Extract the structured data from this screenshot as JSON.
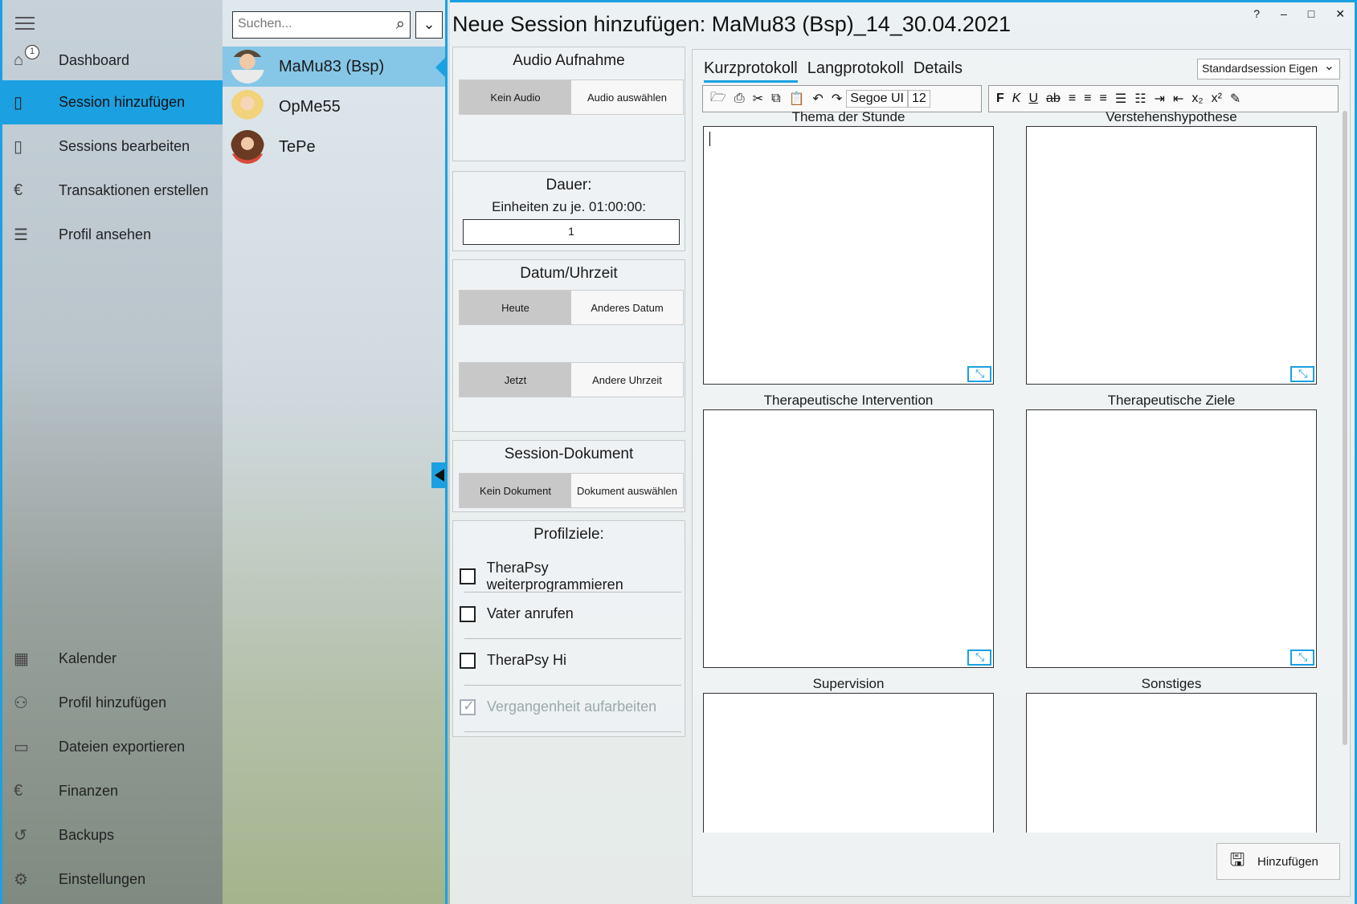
{
  "nav": {
    "dashboard_badge": "1",
    "items_top": [
      {
        "label": "Dashboard",
        "icon": "home-icon"
      },
      {
        "label": "Session hinzufügen",
        "icon": "document-add-icon"
      },
      {
        "label": "Sessions bearbeiten",
        "icon": "document-view-icon"
      },
      {
        "label": "Transaktionen erstellen",
        "icon": "euro-document-icon"
      },
      {
        "label": "Profil ansehen",
        "icon": "person-list-icon"
      }
    ],
    "items_bottom": [
      {
        "label": "Kalender",
        "icon": "calendar-icon"
      },
      {
        "label": "Profil hinzufügen",
        "icon": "people-icon"
      },
      {
        "label": "Dateien exportieren",
        "icon": "export-icon"
      },
      {
        "label": "Finanzen",
        "icon": "euro-icon"
      },
      {
        "label": "Backups",
        "icon": "history-icon"
      },
      {
        "label": "Einstellungen",
        "icon": "gear-icon"
      }
    ]
  },
  "search": {
    "placeholder": "Suchen..."
  },
  "clients": [
    {
      "name": "MaMu83 (Bsp)"
    },
    {
      "name": "OpMe55"
    },
    {
      "name": "TePe"
    }
  ],
  "main": {
    "title": "Neue Session hinzufügen: MaMu83 (Bsp)_14_30.04.2021",
    "window_buttons": [
      "?",
      "–",
      "□",
      "✕"
    ],
    "audio": {
      "title": "Audio Aufnahme",
      "opt1": "Kein Audio",
      "opt2": "Audio auswählen"
    },
    "duration": {
      "title": "Dauer:",
      "sub": "Einheiten zu je. 01:00:00:",
      "value": "1"
    },
    "datetime": {
      "title": "Datum/Uhrzeit",
      "date1": "Heute",
      "date2": "Anderes Datum",
      "time1": "Jetzt",
      "time2": "Andere Uhrzeit"
    },
    "document": {
      "title": "Session-Dokument",
      "opt1": "Kein Dokument",
      "opt2": "Dokument auswählen"
    },
    "goals": {
      "title": "Profilziele:",
      "items": [
        {
          "label": "TheraPsy weiterprogrammieren",
          "checked": false
        },
        {
          "label": "Vater anrufen",
          "checked": false
        },
        {
          "label": "TheraPsy Hi",
          "checked": false
        },
        {
          "label": "Vergangenheit aufarbeiten",
          "checked": true
        }
      ]
    }
  },
  "editor": {
    "tabs": [
      "Kurzprotokoll",
      "Langprotokoll",
      "Details"
    ],
    "template": "Standardsession Eigen",
    "font": "Segoe UI",
    "size": "12",
    "format_bold": "F",
    "format_italic": "K",
    "format_underline": "U",
    "format_strike": "ab",
    "fields": [
      {
        "label": "Thema der Stunde"
      },
      {
        "label": "Verstehenshypothese"
      },
      {
        "label": "Therapeutische Intervention"
      },
      {
        "label": "Therapeutische Ziele"
      },
      {
        "label": "Supervision"
      },
      {
        "label": "Sonstiges"
      }
    ],
    "add_label": "Hinzufügen"
  }
}
